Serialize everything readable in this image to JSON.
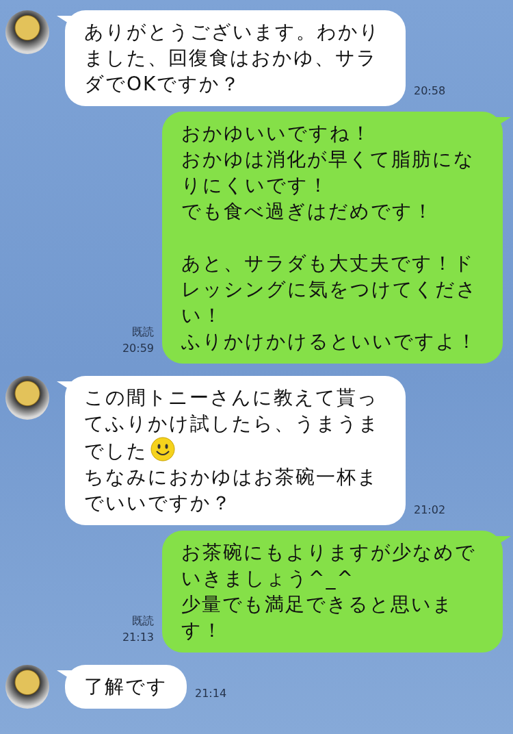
{
  "messages": [
    {
      "kind": "incoming",
      "parts": [
        {
          "kind": "text",
          "text": "ありがとうございます。わかりました、回復食はおかゆ、サラダでOKですか？"
        }
      ],
      "time": "20:58"
    },
    {
      "kind": "outgoing",
      "parts": [
        {
          "kind": "text",
          "text": "おかゆいいですね！"
        },
        {
          "kind": "text",
          "text": "おかゆは消化が早くて脂肪になりにくいです！"
        },
        {
          "kind": "text",
          "text": "でも食べ過ぎはだめです！"
        },
        {
          "kind": "text",
          "text": "あと、サラダも大丈夫です！ドレッシングに気をつけてください！",
          "space_before": true
        },
        {
          "kind": "text",
          "text": "ふりかけかけるといいですよ！"
        }
      ],
      "read": "既読",
      "time": "20:59"
    },
    {
      "kind": "incoming",
      "parts": [
        {
          "kind": "text_with_emoji",
          "text": "この間トニーさんに教えて貰ってふりかけ試したら、うまうま",
          "tail": "でした"
        },
        {
          "kind": "text",
          "text": "ちなみにおかゆはお茶碗一杯までいいですか？"
        }
      ],
      "time": "21:02"
    },
    {
      "kind": "outgoing",
      "parts": [
        {
          "kind": "text",
          "text": "お茶碗にもよりますが少なめでいきましょう^_^"
        },
        {
          "kind": "text",
          "text": "少量でも満足できると思います！"
        }
      ],
      "read": "既読",
      "time": "21:13"
    },
    {
      "kind": "incoming",
      "parts": [
        {
          "kind": "text",
          "text": "了解です"
        }
      ],
      "time": "21:14"
    }
  ]
}
